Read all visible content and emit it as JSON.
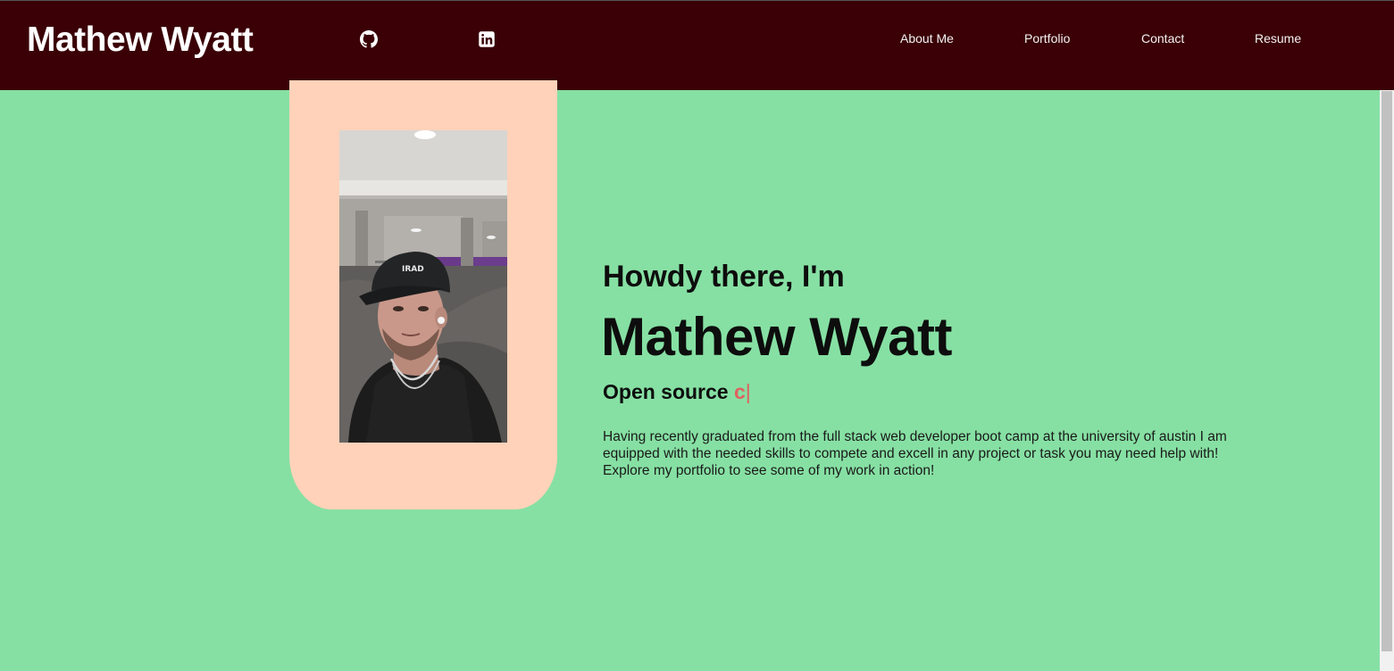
{
  "header": {
    "brand": "Mathew Wyatt",
    "social": [
      {
        "icon": "github-icon"
      },
      {
        "icon": "linkedin-icon"
      }
    ],
    "nav": [
      {
        "label": "About Me"
      },
      {
        "label": "Portfolio"
      },
      {
        "label": "Contact"
      },
      {
        "label": "Resume"
      }
    ]
  },
  "hero": {
    "greeting": "Howdy there, I'm",
    "name": "Mathew Wyatt",
    "tagline_prefix": "Open source",
    "tagline_typed": "c",
    "tagline_cursor": "|",
    "bio": "Having recently graduated from the full stack web developer boot camp at the university of austin I am equipped with the needed skills to compete and excell in any project or task you may need help with! Explore my portfolio to see some of my work in action!"
  },
  "colors": {
    "header_bg": "#3a0006",
    "page_bg": "#86e0a3",
    "photo_card_bg": "#ffd2b9",
    "accent_typed": "#e06060"
  }
}
